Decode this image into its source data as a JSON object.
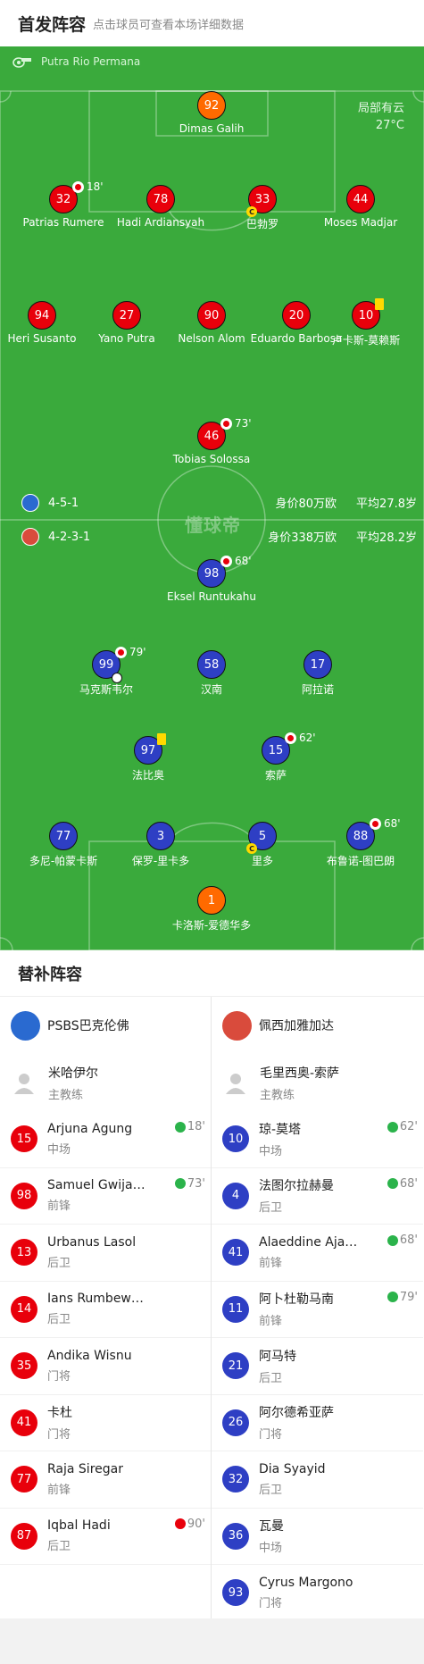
{
  "header": {
    "title": "首发阵容",
    "subtitle": "点击球员可查看本场详细数据"
  },
  "referee": {
    "name": "Putra Rio Permana"
  },
  "weather": {
    "condition": "局部有云",
    "temp": "27°C"
  },
  "watermark": "懂球帝",
  "home_team": {
    "formation": "4-5-1",
    "value": "身价80万欧",
    "age": "平均27.8岁",
    "color": "#e8000b"
  },
  "away_team": {
    "formation": "4-2-3-1",
    "value": "身价338万欧",
    "age": "平均28.2岁",
    "color": "#2e3fc4"
  },
  "home_players": [
    {
      "num": "92",
      "name": "Dimas Galih"
    },
    {
      "num": "32",
      "name": "Patrias Rumere",
      "sub": "18'"
    },
    {
      "num": "78",
      "name": "Hadi Ardiansyah"
    },
    {
      "num": "33",
      "name": "巴勃罗",
      "captain": "C"
    },
    {
      "num": "44",
      "name": "Moses Madjar"
    },
    {
      "num": "94",
      "name": "Heri Susanto"
    },
    {
      "num": "27",
      "name": "Yano Putra"
    },
    {
      "num": "90",
      "name": "Nelson Alom"
    },
    {
      "num": "20",
      "name": "Eduardo Barbosa"
    },
    {
      "num": "10",
      "name": "卢卡斯-莫赖斯"
    },
    {
      "num": "46",
      "name": "Tobias Solossa",
      "sub": "73'"
    }
  ],
  "away_players": [
    {
      "num": "98",
      "name": "Eksel Runtukahu",
      "sub": "68'"
    },
    {
      "num": "99",
      "name": "马克斯韦尔",
      "sub": "79'"
    },
    {
      "num": "58",
      "name": "汉南"
    },
    {
      "num": "17",
      "name": "阿拉诺"
    },
    {
      "num": "97",
      "name": "法比奥"
    },
    {
      "num": "15",
      "name": "索萨",
      "sub": "62'"
    },
    {
      "num": "77",
      "name": "多尼-帕蒙卡斯"
    },
    {
      "num": "3",
      "name": "保罗-里卡多"
    },
    {
      "num": "5",
      "name": "里多",
      "captain": "C"
    },
    {
      "num": "88",
      "name": "布鲁诺-图巴朗",
      "sub": "68'"
    },
    {
      "num": "1",
      "name": "卡洛斯-爱德华多"
    }
  ],
  "subs": {
    "title": "替补阵容",
    "home": {
      "team": "PSBS巴克伦佛",
      "coach": {
        "name": "米哈伊尔",
        "role": "主教练"
      },
      "players": [
        {
          "num": "15",
          "name": "Arjuna Agung",
          "pos": "中场",
          "ev": "18'",
          "evtype": "in"
        },
        {
          "num": "98",
          "name": "Samuel Gwija…",
          "pos": "前锋",
          "ev": "73'",
          "evtype": "in"
        },
        {
          "num": "13",
          "name": "Urbanus Lasol",
          "pos": "后卫"
        },
        {
          "num": "14",
          "name": "Ians Rumbew…",
          "pos": "后卫"
        },
        {
          "num": "35",
          "name": "Andika Wisnu",
          "pos": "门将"
        },
        {
          "num": "41",
          "name": "卡杜",
          "pos": "门将"
        },
        {
          "num": "77",
          "name": "Raja Siregar",
          "pos": "前锋"
        },
        {
          "num": "87",
          "name": "Iqbal Hadi",
          "pos": "后卫",
          "ev": "90'",
          "evtype": "out"
        }
      ]
    },
    "away": {
      "team": "佩西加雅加达",
      "coach": {
        "name": "毛里西奥-索萨",
        "role": "主教练"
      },
      "players": [
        {
          "num": "10",
          "name": "琼-莫塔",
          "pos": "中场",
          "ev": "62'",
          "evtype": "in"
        },
        {
          "num": "4",
          "name": "法图尔拉赫曼",
          "pos": "后卫",
          "ev": "68'",
          "evtype": "in"
        },
        {
          "num": "41",
          "name": "Alaeddine Aja…",
          "pos": "前锋",
          "ev": "68'",
          "evtype": "in"
        },
        {
          "num": "11",
          "name": "阿卜杜勒马南",
          "pos": "前锋",
          "ev": "79'",
          "evtype": "in"
        },
        {
          "num": "21",
          "name": "阿马特",
          "pos": "后卫"
        },
        {
          "num": "26",
          "name": "阿尔德希亚萨",
          "pos": "门将"
        },
        {
          "num": "32",
          "name": "Dia Syayid",
          "pos": "后卫"
        },
        {
          "num": "36",
          "name": "瓦曼",
          "pos": "中场"
        },
        {
          "num": "93",
          "name": "Cyrus Margono",
          "pos": "门将"
        }
      ]
    }
  }
}
